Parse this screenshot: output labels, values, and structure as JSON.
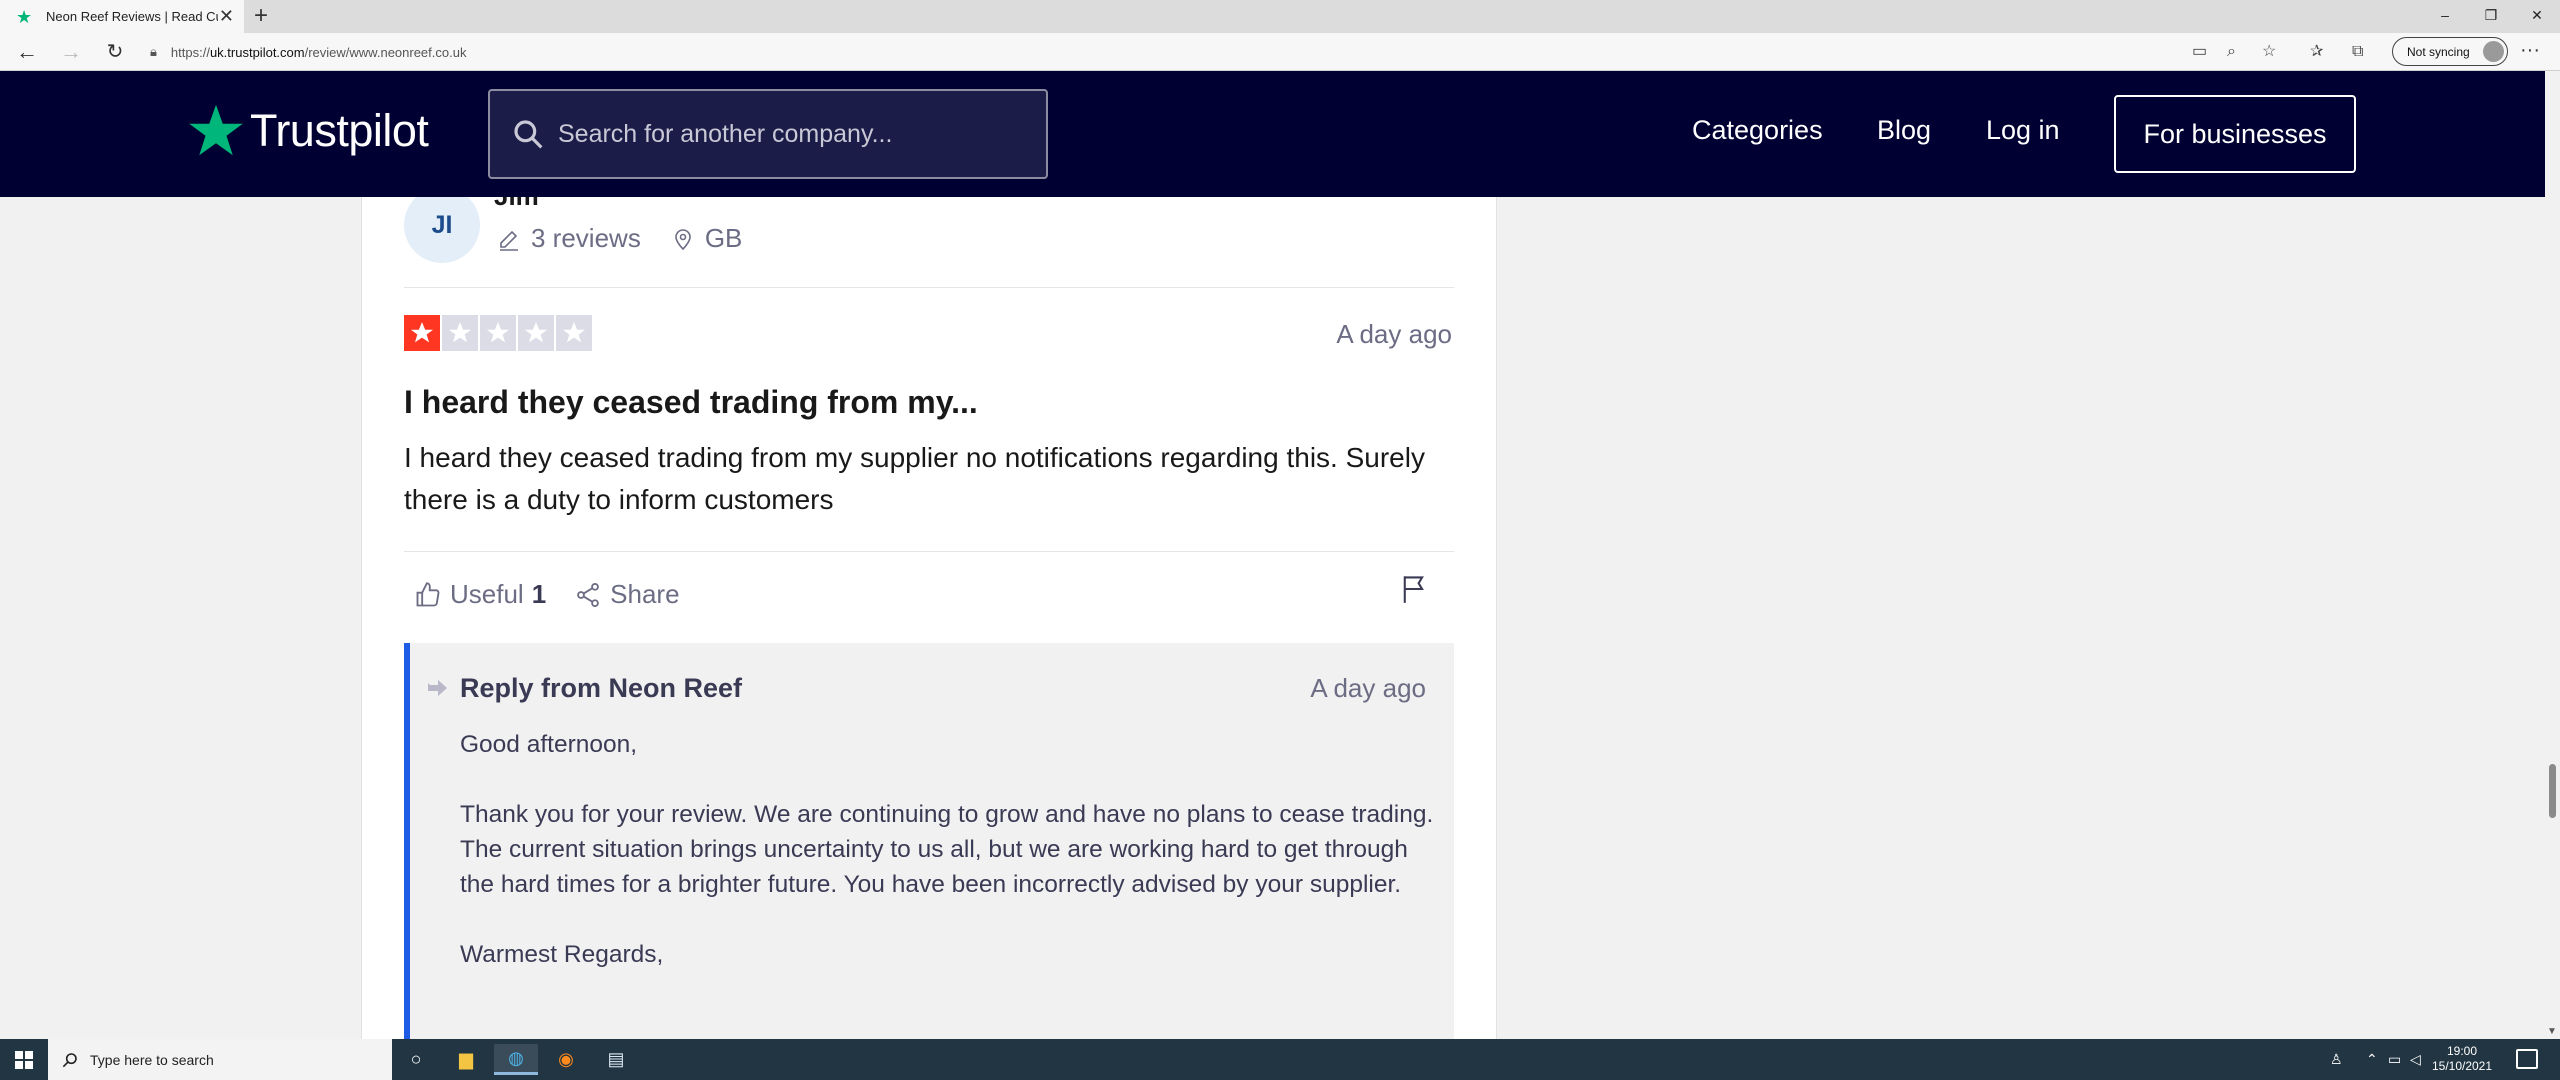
{
  "browser": {
    "tab_title": "Neon Reef Reviews | Read Customer Service Reviews",
    "url_prefix": "https://",
    "url_domain": "uk.trustpilot.com",
    "url_path": "/review/www.neonreef.co.uk",
    "sync_label": "Not syncing"
  },
  "header": {
    "logo_text": "Trustpilot",
    "search_placeholder": "Search for another company...",
    "nav": {
      "categories": "Categories",
      "blog": "Blog",
      "login": "Log in",
      "businesses": "For businesses"
    }
  },
  "review": {
    "reviewer_initials": "JI",
    "reviewer_name": "Jim",
    "review_count": "3 reviews",
    "country": "GB",
    "rating": 1,
    "max_rating": 5,
    "rating_color": "#ff3722",
    "empty_star_color": "#dcdce6",
    "date": "A day ago",
    "title": "I heard they ceased trading from my...",
    "text": "I heard they ceased trading from my supplier no notifications regarding this. Surely there is a duty to inform customers",
    "useful_label": "Useful",
    "useful_count": "1",
    "share_label": "Share"
  },
  "reply": {
    "from": "Reply from Neon Reef",
    "date": "A day ago",
    "text": "Good afternoon,\n\nThank you for your review. We are continuing to grow and have no plans to cease trading. The current situation brings uncertainty to us all, but we are working hard to get through the hard times for a brighter future. You have been incorrectly advised by your supplier.\n\nWarmest Regards,"
  },
  "taskbar": {
    "search_placeholder": "Type here to search",
    "time": "19:00",
    "date": "15/10/2021"
  },
  "colors": {
    "brand_green": "#00b67a",
    "header_bg": "#000032",
    "reply_accent": "#1f5ce6"
  }
}
